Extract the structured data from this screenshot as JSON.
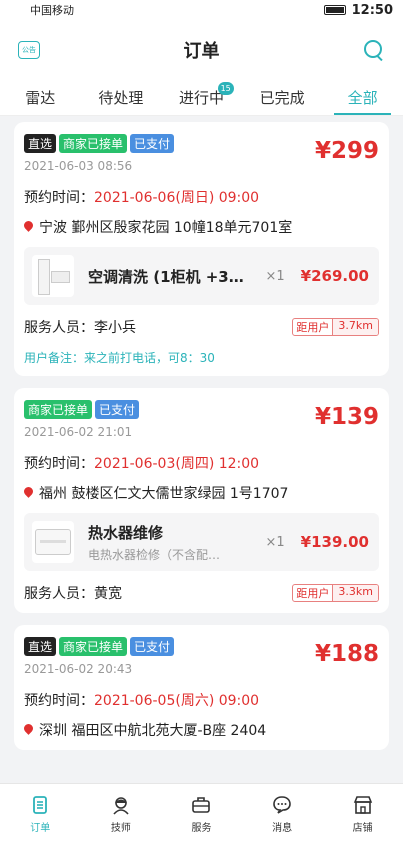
{
  "status_bar": {
    "carrier": "中国移动",
    "time": "12:50"
  },
  "header": {
    "notice_label": "公告",
    "title": "订单"
  },
  "tabs": [
    {
      "label": "雷达",
      "badge": ""
    },
    {
      "label": "待处理",
      "badge": ""
    },
    {
      "label": "进行中",
      "badge": "15"
    },
    {
      "label": "已完成",
      "badge": ""
    },
    {
      "label": "全部",
      "badge": ""
    }
  ],
  "active_tab": "全部",
  "colors": {
    "accent": "#2bb3b9",
    "price": "#e0302f",
    "tag_direct": "#222222",
    "tag_accepted": "#29c06c",
    "tag_paid": "#4a8fe0"
  },
  "orders": [
    {
      "tags": {
        "direct": "直选",
        "accepted": "商家已接单",
        "paid": "已支付"
      },
      "order_time": "2021-06-03 08:56",
      "total_price": "¥299",
      "appt_label": "预约时间：",
      "appt_value": "2021-06-06(周日) 09:00",
      "address": "宁波 鄞州区殷家花园 10幢18单元701室",
      "service": {
        "name": "空调清洗 (1柜机 +3…",
        "desc": "",
        "qty": "×1",
        "price": "¥269.00",
        "image": "air-conditioner"
      },
      "staff_label": "服务人员：",
      "staff_name": "李小兵",
      "distance_label": "距用户",
      "distance_value": "3.7km",
      "note": "用户备注：来之前打电话，可8：30"
    },
    {
      "tags": {
        "accepted": "商家已接单",
        "paid": "已支付"
      },
      "order_time": "2021-06-02 21:01",
      "total_price": "¥139",
      "appt_label": "预约时间：",
      "appt_value": "2021-06-03(周四) 12:00",
      "address": "福州 鼓楼区仁文大儒世家绿园 1号1707",
      "service": {
        "name": "热水器维修",
        "desc": "电热水器检修（不含配…",
        "qty": "×1",
        "price": "¥139.00",
        "image": "water-heater"
      },
      "staff_label": "服务人员：",
      "staff_name": "黄宽",
      "distance_label": "距用户",
      "distance_value": "3.3km"
    },
    {
      "tags": {
        "direct": "直选",
        "accepted": "商家已接单",
        "paid": "已支付"
      },
      "order_time": "2021-06-02 20:43",
      "total_price": "¥188",
      "appt_label": "预约时间：",
      "appt_value": "2021-06-05(周六) 09:00",
      "address": "深圳 福田区中航北苑大厦-B座 2404"
    }
  ],
  "bottom_nav": [
    {
      "label": "订单",
      "icon": "order-icon"
    },
    {
      "label": "技师",
      "icon": "technician-icon"
    },
    {
      "label": "服务",
      "icon": "service-toolbox-icon"
    },
    {
      "label": "消息",
      "icon": "message-icon"
    },
    {
      "label": "店铺",
      "icon": "shop-icon"
    }
  ]
}
